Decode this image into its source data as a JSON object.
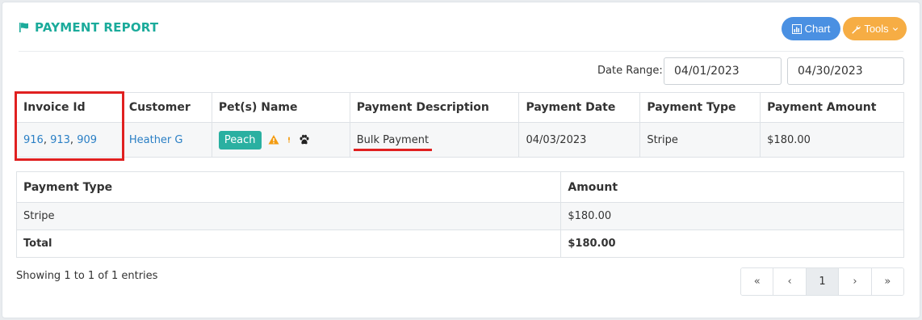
{
  "header": {
    "title": "PAYMENT REPORT",
    "chart_label": "Chart",
    "tools_label": "Tools"
  },
  "filters": {
    "date_range_label": "Date Range:",
    "date_from": "04/01/2023",
    "date_to": "04/30/2023"
  },
  "payments_table": {
    "columns": [
      "Invoice Id",
      "Customer",
      "Pet(s) Name",
      "Payment Description",
      "Payment Date",
      "Payment Type",
      "Payment Amount"
    ],
    "rows": [
      {
        "invoices": [
          "916",
          "913",
          "909"
        ],
        "customer": "Heather G",
        "pet": "Peach",
        "description": "Bulk Payment",
        "date": "04/03/2023",
        "type": "Stripe",
        "amount": "$180.00"
      }
    ]
  },
  "summary_table": {
    "columns": [
      "Payment Type",
      "Amount"
    ],
    "rows": [
      {
        "type": "Stripe",
        "amount": "$180.00"
      }
    ],
    "total_label": "Total",
    "total_amount": "$180.00"
  },
  "footer": {
    "entries_text": "Showing 1 to 1 of 1 entries",
    "pagination": {
      "first": "«",
      "prev": "‹",
      "page": "1",
      "next": "›",
      "last": "»"
    }
  },
  "colors": {
    "brand": "#1bab9b",
    "chart_button": "#4a90e2",
    "tools_button": "#f6ad44",
    "badge": "#2ab0a1",
    "link": "#2a7fc5",
    "annotation": "#e02020"
  },
  "icons": [
    "flag-icon",
    "bar-chart-icon",
    "wrench-icon",
    "chevron-down-icon",
    "warning-icon",
    "exclamation-icon",
    "paw-icon"
  ]
}
